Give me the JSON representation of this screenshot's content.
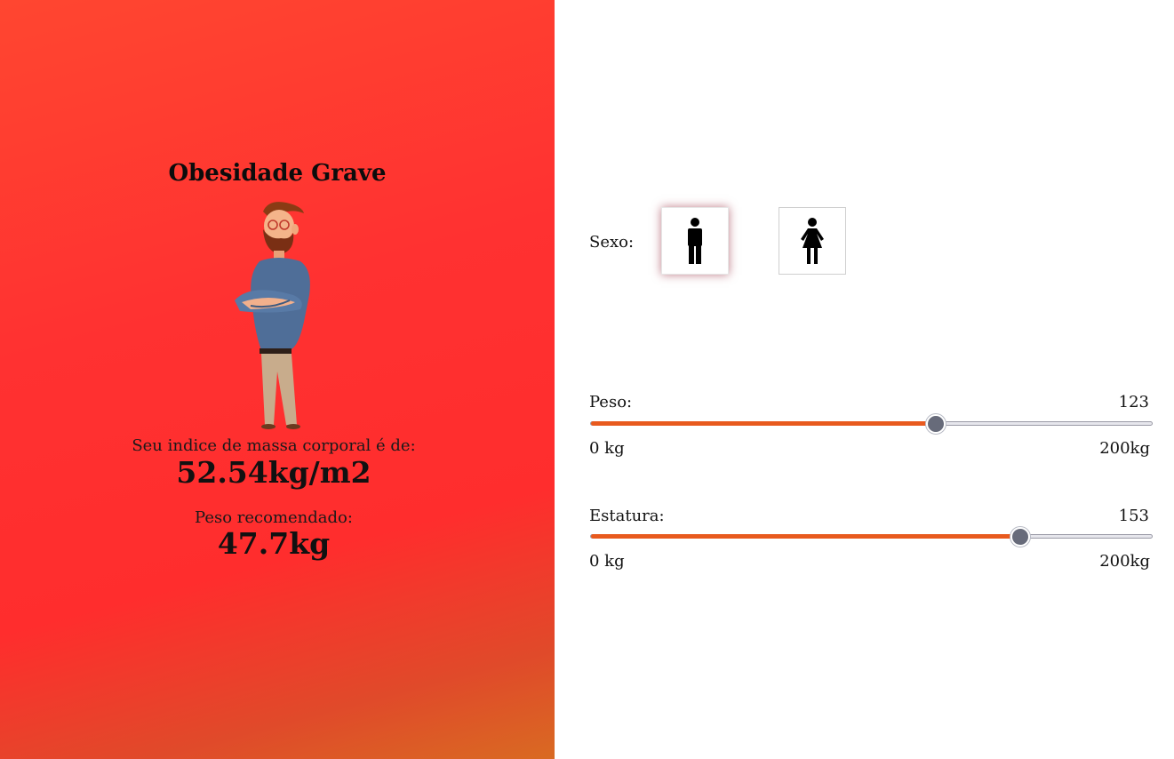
{
  "result": {
    "classification": "Obesidade Grave",
    "bmi_label": "Seu indice de massa corporal é de:",
    "bmi_value": "52.54kg/m2",
    "recommended_label": "Peso recomendado:",
    "recommended_value": "47.7kg"
  },
  "form": {
    "sex_label": "Sexo:",
    "sex_options": [
      {
        "icon": "male-icon",
        "selected": true
      },
      {
        "icon": "female-icon",
        "selected": false
      }
    ],
    "weight": {
      "label": "Peso:",
      "value": "123",
      "value_number": 123,
      "min": 0,
      "max": 200,
      "min_label": "0 kg",
      "max_label": "200kg"
    },
    "height": {
      "label": "Estatura:",
      "value": "153",
      "value_number": 153,
      "min": 0,
      "max": 200,
      "min_label": "0 kg",
      "max_label": "200kg"
    }
  },
  "colors": {
    "panel_gradient_top": "#ff4630",
    "panel_gradient_bottom": "#d96a22",
    "slider_fill": "#e85a1e",
    "slider_thumb": "#676b7a"
  }
}
